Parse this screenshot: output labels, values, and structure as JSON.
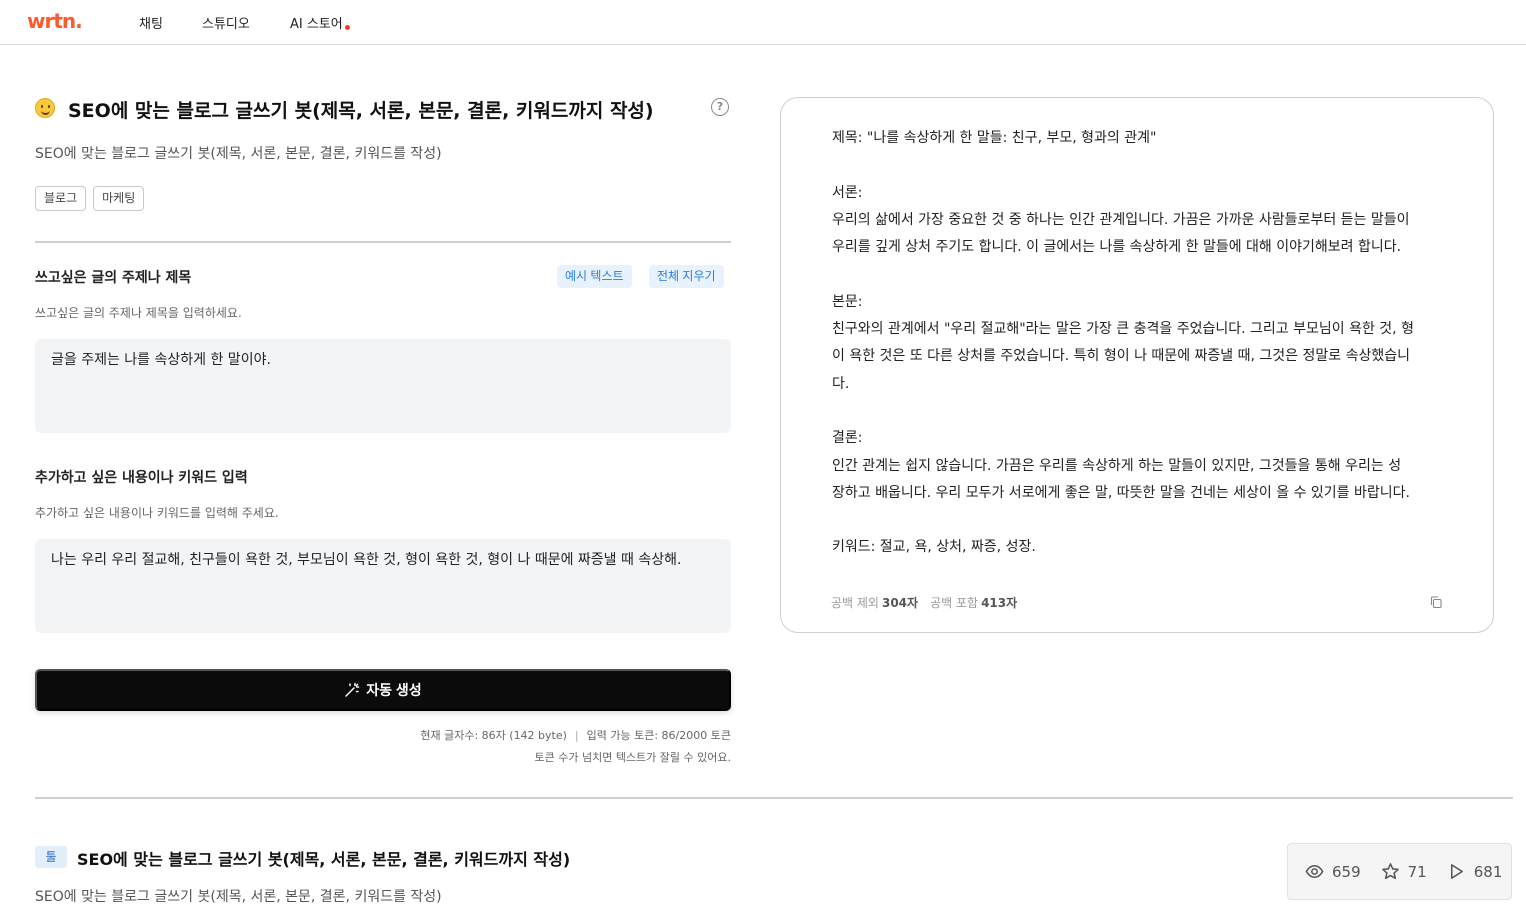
{
  "nav": {
    "logo": "wrtn.",
    "items": [
      {
        "label": "채팅"
      },
      {
        "label": "스튜디오"
      },
      {
        "label": "AI 스토어"
      }
    ]
  },
  "tool": {
    "title": "SEO에 맞는 블로그 글쓰기 봇(제목, 서론, 본문, 결론, 키워드까지 작성)",
    "subtitle": "SEO에 맞는 블로그 글쓰기 봇(제목, 서론, 본문, 결론, 키워드를 작성)",
    "tags": [
      "블로그",
      "마케팅"
    ]
  },
  "form": {
    "field1": {
      "label": "쓰고싶은 글의 주제나 제목",
      "help": "쓰고싶은 글의 주제나 제목을 입력하세요.",
      "value": "글을 주제는 나를 속상하게 한 말이야."
    },
    "example_button": "예시 텍스트",
    "clear_button": "전체 지우기",
    "field2": {
      "label": "추가하고 싶은 내용이나 키워드 입력",
      "help": "추가하고 싶은 내용이나 키워드를 입력해 주세요.",
      "value": "나는 우리 우리 절교해, 친구들이 욕한 것, 부모님이 욕한 것, 형이 욕한 것, 형이 나 때문에 짜증낼 때 속상해."
    },
    "generate_button": "자동 생성",
    "char_count": "현재 글자수: 86자 (142 byte)",
    "token_count": "입력 가능 토큰: 86/2000 토큰",
    "token_warning": "토큰 수가 넘치면 텍스트가 잘릴 수 있어요."
  },
  "output": {
    "lines": [
      "제목: \"나를 속상하게 한 말들: 친구, 부모, 형과의 관계\"",
      "",
      "서론:",
      "우리의 삶에서 가장 중요한 것 중 하나는 인간 관계입니다. 가끔은 가까운 사람들로부터 듣는 말들이",
      "우리를 깊게 상처 주기도 합니다. 이 글에서는 나를 속상하게 한 말들에 대해 이야기해보려 합니다.",
      "",
      "본문:",
      "친구와의 관계에서 \"우리 절교해\"라는 말은 가장 큰 충격을 주었습니다. 그리고 부모님이 욕한 것, 형",
      "이 욕한 것은 또 다른 상처를 주었습니다. 특히 형이 나 때문에 짜증낼 때, 그것은 정말로 속상했습니",
      "다.",
      "",
      "결론:",
      "인간 관계는 쉽지 않습니다. 가끔은 우리를 속상하게 하는 말들이 있지만, 그것들을 통해 우리는 성",
      "장하고 배웁니다. 우리 모두가 서로에게 좋은 말, 따뜻한 말을 건네는 세상이 올 수 있기를 바랍니다.",
      "",
      "키워드: 절교, 욕, 상처, 짜증, 성장."
    ],
    "excl_label": "공백 제외",
    "excl_value": "304자",
    "incl_label": "공백 포함",
    "incl_value": "413자"
  },
  "info": {
    "badge": "툴",
    "title": "SEO에 맞는 블로그 글쓰기 봇(제목, 서론, 본문, 결론, 키워드까지 작성)",
    "subtitle": "SEO에 맞는 블로그 글쓰기 봇(제목, 서론, 본문, 결론, 키워드를 작성)",
    "views": "659",
    "stars": "71",
    "runs": "681"
  },
  "colors": {
    "brand": "#ff5a2c",
    "accent_blue": "#2a7de1",
    "button_dark": "#0b0b0b"
  }
}
